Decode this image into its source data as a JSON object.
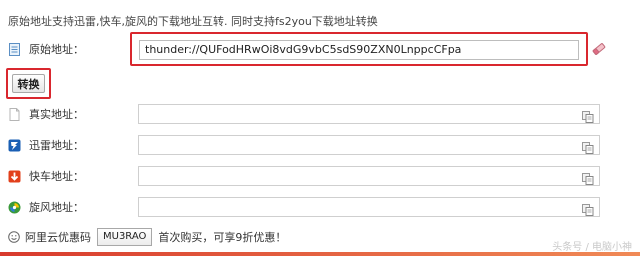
{
  "intro_text": "原始地址支持迅雷,快车,旋风的下载地址互转. 同时支持fs2you下载地址转换",
  "original": {
    "label": "原始地址：",
    "value": "thunder://QUFodHRwOi8vdG9vbC5sdS90ZXN0LnppcCFpa",
    "icon": "document-icon"
  },
  "convert_button": "转换",
  "rows": [
    {
      "label": "真实地址：",
      "icon": "blank-page-icon",
      "value": ""
    },
    {
      "label": "迅雷地址：",
      "icon": "thunder-icon",
      "value": ""
    },
    {
      "label": "快车地址：",
      "icon": "flashget-icon",
      "value": ""
    },
    {
      "label": "旋风地址：",
      "icon": "qqxuanfeng-icon",
      "value": ""
    }
  ],
  "promo": {
    "prefix": "阿里云优惠码",
    "code": "MU3RAO",
    "suffix": "首次购买，可享9折优惠！"
  },
  "watermark": "头条号 / 电脑小神",
  "colors": {
    "highlight": "#d9272e",
    "accent_bar": "#e0553a"
  }
}
